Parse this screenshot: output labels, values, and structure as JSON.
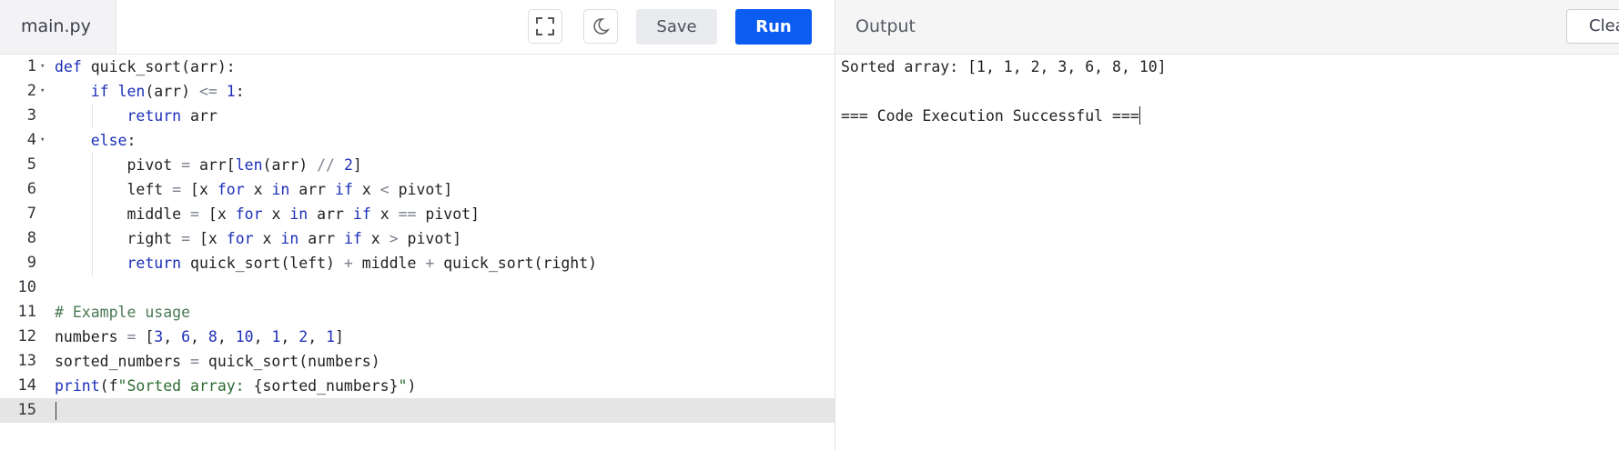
{
  "editor": {
    "file_tab": "main.py",
    "fullscreen_icon": "fullscreen-icon",
    "theme_icon": "moon-icon",
    "save_label": "Save",
    "run_label": "Run"
  },
  "code": {
    "lines": [
      {
        "n": "1",
        "fold": true
      },
      {
        "n": "2",
        "fold": true
      },
      {
        "n": "3",
        "fold": false
      },
      {
        "n": "4",
        "fold": true
      },
      {
        "n": "5",
        "fold": false
      },
      {
        "n": "6",
        "fold": false
      },
      {
        "n": "7",
        "fold": false
      },
      {
        "n": "8",
        "fold": false
      },
      {
        "n": "9",
        "fold": false
      },
      {
        "n": "10",
        "fold": false
      },
      {
        "n": "11",
        "fold": false
      },
      {
        "n": "12",
        "fold": false
      },
      {
        "n": "13",
        "fold": false
      },
      {
        "n": "14",
        "fold": false
      },
      {
        "n": "15",
        "fold": false
      }
    ],
    "tokens": {
      "l1": {
        "def": "def",
        "rest": " quick_sort(arr):"
      },
      "l2": {
        "if": "if",
        "len": "len",
        "a": "(arr) ",
        "le": "<=",
        "one": "1",
        "b": ":"
      },
      "l3": {
        "ret": "return",
        "a": " arr"
      },
      "l4": {
        "else": "else",
        "a": ":"
      },
      "l5": {
        "a": "pivot ",
        "eq": "=",
        "b": " arr[",
        "len": "len",
        "c": "(arr) ",
        "div": "//",
        "two": "2",
        "d": "]"
      },
      "l6": {
        "a": "left ",
        "eq": "=",
        "b": " [x ",
        "for": "for",
        "c": " x ",
        "in": "in",
        "d": " arr ",
        "if": "if",
        "e": " x ",
        "lt": "<",
        "f": " pivot]"
      },
      "l7": {
        "a": "middle ",
        "eq": "=",
        "b": " [x ",
        "for": "for",
        "c": " x ",
        "in": "in",
        "d": " arr ",
        "if": "if",
        "e": " x ",
        "eqeq": "==",
        "f": " pivot]"
      },
      "l8": {
        "a": "right ",
        "eq": "=",
        "b": " [x ",
        "for": "for",
        "c": " x ",
        "in": "in",
        "d": " arr ",
        "if": "if",
        "e": " x ",
        "gt": ">",
        "f": " pivot]"
      },
      "l9": {
        "ret": "return",
        "a": " quick_sort(left) ",
        "plus1": "+",
        "b": " middle ",
        "plus2": "+",
        "c": " quick_sort(right)"
      },
      "l11": {
        "cmt": "# Example usage"
      },
      "l12": {
        "a": "numbers ",
        "eq": "=",
        "b": " [",
        "n1": "3",
        "c1": ", ",
        "n2": "6",
        "c2": ", ",
        "n3": "8",
        "c3": ", ",
        "n4": "10",
        "c4": ", ",
        "n5": "1",
        "c5": ", ",
        "n6": "2",
        "c6": ", ",
        "n7": "1",
        "d": "]"
      },
      "l13": {
        "a": "sorted_numbers ",
        "eq": "=",
        "b": " quick_sort(numbers)"
      },
      "l14": {
        "print": "print",
        "a": "(f",
        "s1": "\"Sorted array: ",
        "b": "{sorted_numbers}",
        "s2": "\"",
        "c": ")"
      }
    }
  },
  "output": {
    "title": "Output",
    "clear_label": "Clear",
    "lines": [
      "Sorted array: [1, 1, 2, 3, 6, 8, 10]",
      "",
      "=== Code Execution Successful ==="
    ]
  }
}
